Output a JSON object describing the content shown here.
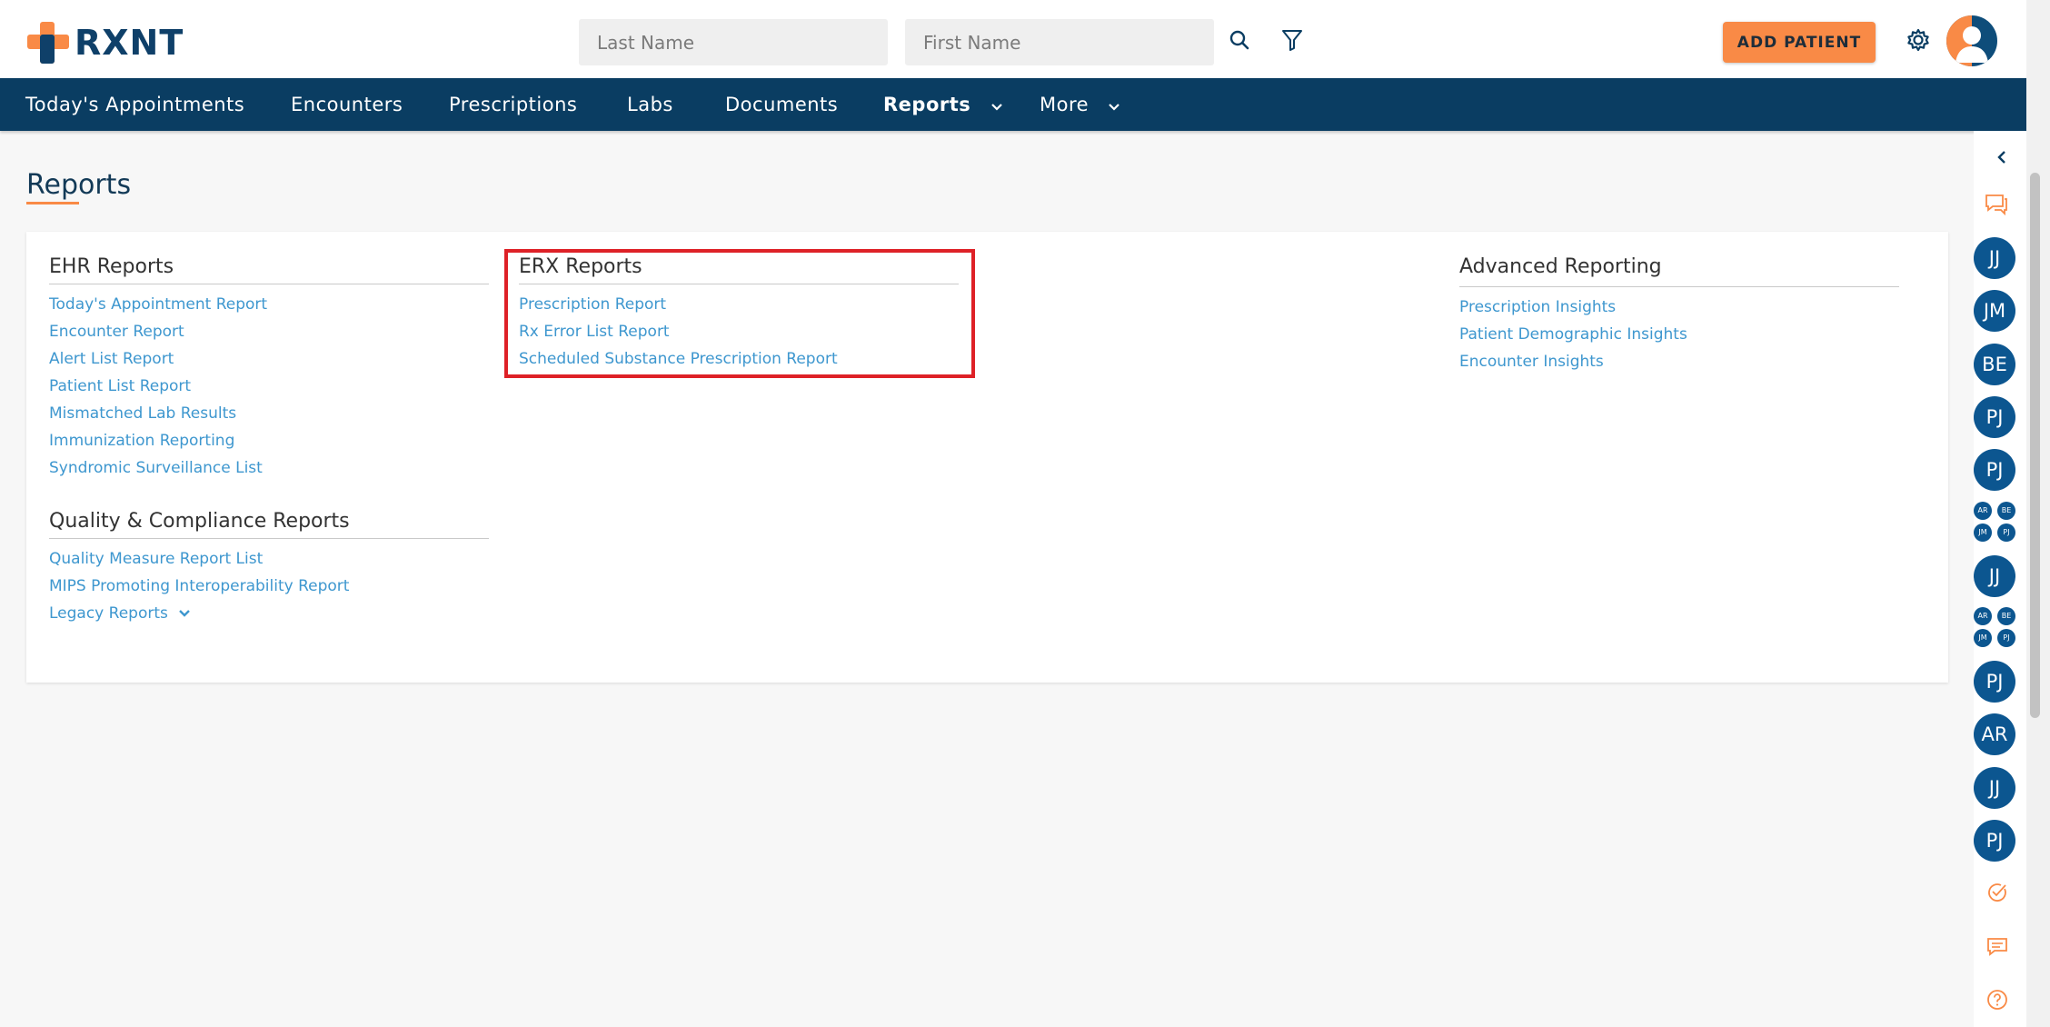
{
  "brand": {
    "name": "RXNT",
    "primary": "#0a3d62",
    "accent": "#f98a46",
    "link": "#3e97cf",
    "highlight": "#de2127"
  },
  "header": {
    "last_name_placeholder": "Last Name",
    "first_name_placeholder": "First Name",
    "add_patient_label": "ADD PATIENT",
    "icons": [
      "search-icon",
      "filter-icon",
      "gear-icon",
      "user-avatar-icon"
    ]
  },
  "nav": {
    "items": [
      {
        "label": "Today's Appointments"
      },
      {
        "label": "Encounters"
      },
      {
        "label": "Prescriptions"
      },
      {
        "label": "Labs"
      },
      {
        "label": "Documents"
      },
      {
        "label": "Reports",
        "active": true
      },
      {
        "label": "More"
      }
    ]
  },
  "page": {
    "title": "Reports"
  },
  "sections": {
    "ehr": {
      "title": "EHR Reports",
      "links": [
        "Today's Appointment Report",
        "Encounter Report",
        "Alert List Report",
        "Patient List Report",
        "Mismatched Lab Results",
        "Immunization Reporting",
        "Syndromic Surveillance List"
      ]
    },
    "quality": {
      "title": "Quality & Compliance Reports",
      "links": [
        "Quality Measure Report List",
        "MIPS Promoting Interoperability Report"
      ],
      "legacy_label": "Legacy Reports"
    },
    "erx": {
      "title": "ERX Reports",
      "links": [
        "Prescription Report",
        "Rx Error List Report",
        "Scheduled Substance Prescription Report"
      ]
    },
    "advanced": {
      "title": "Advanced Reporting",
      "links": [
        "Prescription Insights",
        "Patient Demographic Insights",
        "Encounter Insights"
      ]
    }
  },
  "rail": {
    "avatars": [
      "JJ",
      "JM",
      "BE",
      "PJ",
      "PJ",
      "JJ",
      "PJ",
      "AR",
      "JJ",
      "PJ"
    ],
    "group": [
      "AR",
      "BE",
      "JM",
      "PJ"
    ],
    "icons": [
      "collapse-icon",
      "chat-icon",
      "task-check-icon",
      "message-icon",
      "help-icon"
    ]
  }
}
